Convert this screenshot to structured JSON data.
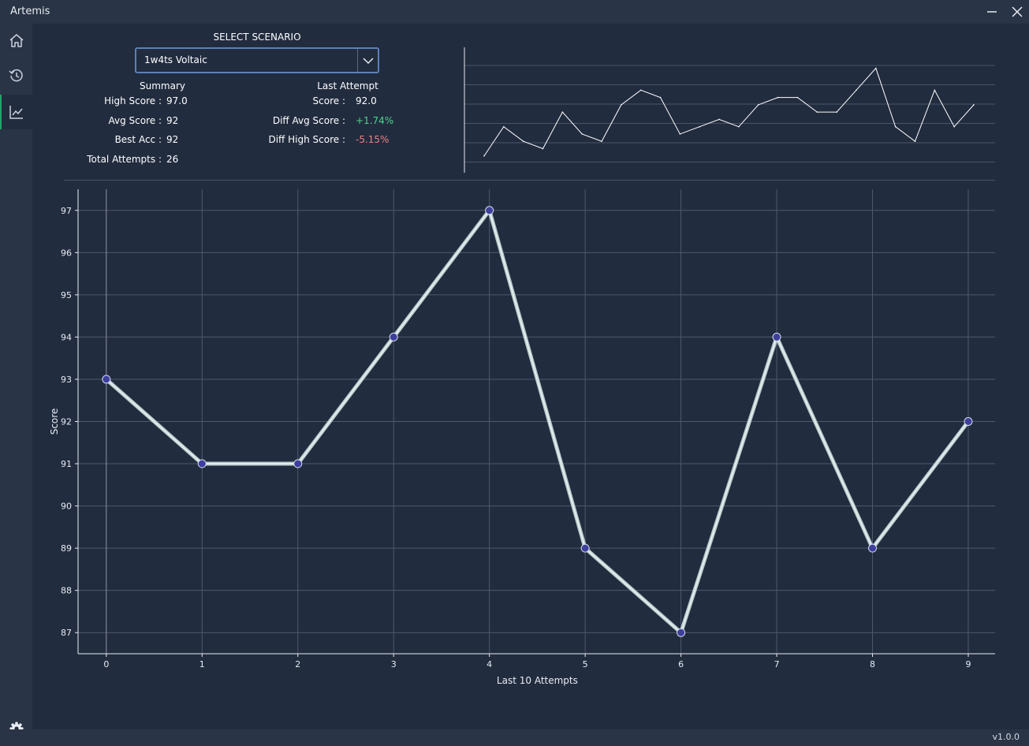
{
  "window": {
    "title": "Artemis",
    "version": "v1.0.0"
  },
  "nav": [
    {
      "name": "home-icon",
      "active": false
    },
    {
      "name": "history-icon",
      "active": false
    },
    {
      "name": "chart-icon",
      "active": true
    }
  ],
  "scenario": {
    "label": "SELECT SCENARIO",
    "selected": "1w4ts Voltaic"
  },
  "summary": {
    "header": "Summary",
    "high_score_label": "High Score :",
    "high_score": "97.0",
    "avg_score_label": "Avg Score :",
    "avg_score": "92",
    "best_acc_label": "Best Acc :",
    "best_acc": "92",
    "total_attempts_label": "Total Attempts :",
    "total_attempts": "26"
  },
  "last_attempt": {
    "header": "Last Attempt",
    "score_label": "Score :",
    "score": "92.0",
    "diff_avg_label": "Diff Avg Score :",
    "diff_avg": "+1.74%",
    "diff_high_label": "Diff High Score :",
    "diff_high": "-5.15%"
  },
  "colors": {
    "positive": "#4fd48a",
    "negative": "#e8827e",
    "accent": "#29a36a",
    "point": "#3c3f9e"
  },
  "chart_data": [
    {
      "type": "line",
      "title": "",
      "values": [
        86,
        90,
        88,
        87,
        92,
        89,
        88,
        93,
        95,
        94,
        89,
        90,
        91,
        90,
        93,
        94,
        94,
        92,
        92,
        95,
        98,
        90,
        88,
        95,
        90,
        93
      ],
      "ylim": [
        85,
        100
      ]
    },
    {
      "type": "line",
      "x": [
        0,
        1,
        2,
        3,
        4,
        5,
        6,
        7,
        8,
        9
      ],
      "values": [
        93,
        91,
        91,
        94,
        97,
        89,
        87,
        94,
        89,
        92
      ],
      "xlabel": "Last 10 Attempts",
      "ylabel": "Score",
      "xticks": [
        "0",
        "1",
        "2",
        "3",
        "4",
        "5",
        "6",
        "7",
        "8",
        "9"
      ],
      "yticks": [
        "87",
        "88",
        "89",
        "90",
        "91",
        "92",
        "93",
        "94",
        "95",
        "96",
        "97"
      ],
      "ylim": [
        86.5,
        97.5
      ],
      "grid": true
    }
  ]
}
